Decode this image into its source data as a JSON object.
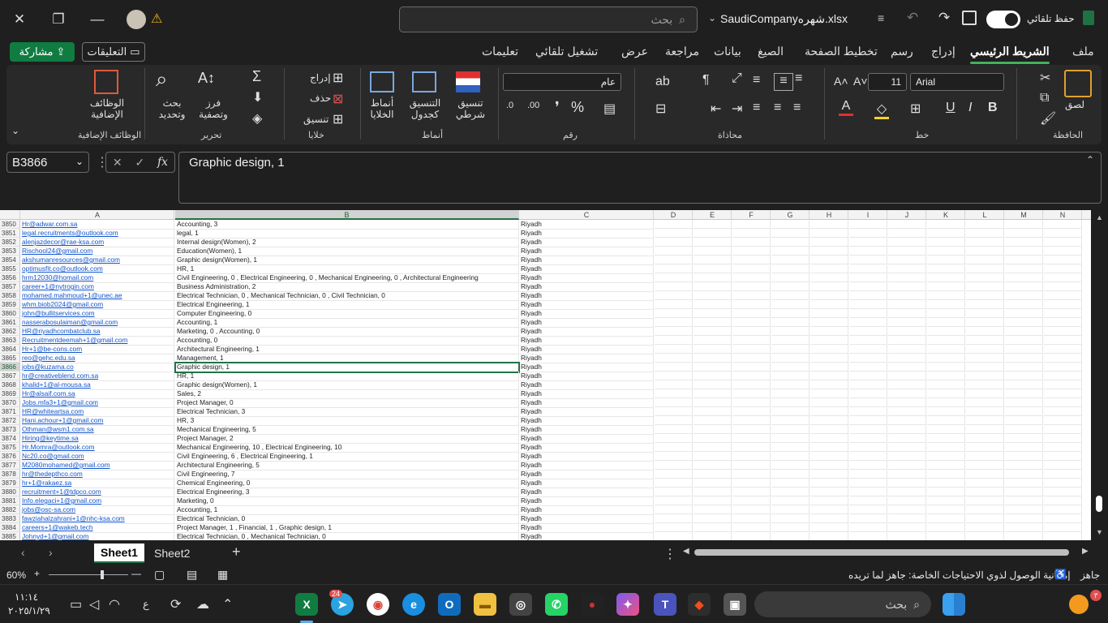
{
  "titlebar": {
    "filename": "SaudiCompanyشهره.xlsx",
    "search_placeholder": "بحث",
    "autosave_label": "حفظ تلقائي"
  },
  "tabs": [
    "ملف",
    "الشريط الرئيسي",
    "إدراج",
    "رسم",
    "تخطيط الصفحة",
    "الصيغ",
    "بيانات",
    "مراجعة",
    "عرض",
    "تشغيل تلقائي",
    "تعليمات"
  ],
  "active_tab": "الشريط الرئيسي",
  "share_label": "مشاركة",
  "comments_label": "التعليقات",
  "ribbon": {
    "clipboard": {
      "label": "الحافظة",
      "paste": "لصق"
    },
    "font": {
      "label": "خط",
      "name": "Arial",
      "size": "11"
    },
    "alignment": {
      "label": "محاذاة"
    },
    "number": {
      "label": "رقم",
      "format": "عام"
    },
    "styles": {
      "label": "أنماط",
      "conditional": "تنسيق شرطي",
      "table": "التنسيق كجدول",
      "cell_styles": "أنماط الخلايا"
    },
    "cells": {
      "label": "خلايا",
      "insert": "إدراج",
      "delete": "حذف",
      "format": "تنسيق"
    },
    "editing": {
      "label": "تحرير",
      "sort": "فرز وتصفية",
      "find": "بحث وتحديد"
    },
    "addins": {
      "label": "الوظائف الإضافية",
      "button": "الوظائف الإضافية"
    }
  },
  "formula_bar": {
    "name_box": "B3866",
    "content": "Graphic design, 1"
  },
  "columns": [
    "A",
    "B",
    "C",
    "D",
    "E",
    "F",
    "G",
    "H",
    "I",
    "J",
    "K",
    "L",
    "M",
    "N"
  ],
  "selected_row": "3866",
  "rows": [
    {
      "n": "3850",
      "a": "Hr@adwar.com.sa",
      "b": "Accounting, 3",
      "c": "Riyadh"
    },
    {
      "n": "3851",
      "a": "legal.recruitments@outlook.com",
      "b": "legal, 1",
      "c": "Riyadh"
    },
    {
      "n": "3852",
      "a": "alenjazdecor@rae-ksa.com",
      "b": "Internal design(Women), 2",
      "c": "Riyadh"
    },
    {
      "n": "3853",
      "a": "Rischool24@gmail.com",
      "b": "Education(Women), 1",
      "c": "Riyadh"
    },
    {
      "n": "3854",
      "a": "akshumanresources@gmail.com",
      "b": "Graphic design(Women), 1",
      "c": "Riyadh"
    },
    {
      "n": "3855",
      "a": "optimusfit.co@outlook.com",
      "b": "HR, 1",
      "c": "Riyadh"
    },
    {
      "n": "3856",
      "a": "hrm12030@homail.com",
      "b": "Civil Engineering, 0  , Electrical Engineering, 0 , Mechanical Engineering, 0 , Architectural Engineering",
      "c": "Riyadh"
    },
    {
      "n": "3857",
      "a": "career+1@nytrogin.com",
      "b": "Business Administration, 2",
      "c": "Riyadh"
    },
    {
      "n": "3858",
      "a": "mohamed.mahmoud+1@unec.ae",
      "b": "Electrical Technician, 0  , Mechanical Technician, 0 , Civil Technician, 0",
      "c": "Riyadh"
    },
    {
      "n": "3859",
      "a": "whm.biob2024@gmail.com",
      "b": "Electrical Engineering, 1",
      "c": "Riyadh"
    },
    {
      "n": "3860",
      "a": "john@bullitservices.com",
      "b": "Computer Engineering, 0",
      "c": "Riyadh"
    },
    {
      "n": "3861",
      "a": "nasserabosulaiman@gmail.com",
      "b": "Accounting, 1",
      "c": "Riyadh"
    },
    {
      "n": "3862",
      "a": "HR@riyadhcombatclub.sa",
      "b": "Marketing, 0 , Accounting, 0",
      "c": "Riyadh"
    },
    {
      "n": "3863",
      "a": "Recruitmentdeemah+1@gmail.com",
      "b": "Accounting, 0",
      "c": "Riyadh"
    },
    {
      "n": "3864",
      "a": "Hr+1@be-cons.com",
      "b": "Architectural Engineering, 1",
      "c": "Riyadh"
    },
    {
      "n": "3865",
      "a": "reo@gehc.edu.sa",
      "b": "Management, 1",
      "c": "Riyadh"
    },
    {
      "n": "3866",
      "a": "jobs@kuzama.co",
      "b": "Graphic design, 1",
      "c": "Riyadh"
    },
    {
      "n": "3867",
      "a": "hr@creativeblend.com.sa",
      "b": "HR, 1",
      "c": "Riyadh"
    },
    {
      "n": "3868",
      "a": "khalid+1@al-mousa.sa",
      "b": "Graphic design(Women), 1",
      "c": "Riyadh"
    },
    {
      "n": "3869",
      "a": "Hr@alsaif.com.sa",
      "b": "Sales, 2",
      "c": "Riyadh"
    },
    {
      "n": "3870",
      "a": "Jobs.mfa3+1@gmail.com",
      "b": "Project Manager, 0",
      "c": "Riyadh"
    },
    {
      "n": "3871",
      "a": "HR@whiteartsa.com",
      "b": "Electrical Technician, 3",
      "c": "Riyadh"
    },
    {
      "n": "3872",
      "a": "Hani.achour+1@gmail.com",
      "b": "HR, 3",
      "c": "Riyadh"
    },
    {
      "n": "3873",
      "a": "Othman@wsm1.com.sa",
      "b": "Mechanical Engineering, 5",
      "c": "Riyadh"
    },
    {
      "n": "3874",
      "a": "Hiring@keytime.sa",
      "b": "Project Manager, 2",
      "c": "Riyadh"
    },
    {
      "n": "3875",
      "a": "Hr.Momra@outlook.com",
      "b": "Mechanical Engineering, 10  , Electrical Engineering, 10",
      "c": "Riyadh"
    },
    {
      "n": "3876",
      "a": "Nc20.co@gmail.com",
      "b": "Civil Engineering, 6  , Electrical Engineering, 1",
      "c": "Riyadh"
    },
    {
      "n": "3877",
      "a": "M2080mohamed@gmail.com",
      "b": "Architectural Engineering, 5",
      "c": "Riyadh"
    },
    {
      "n": "3878",
      "a": "hr@thedepthco.com",
      "b": "Civil Engineering, 7",
      "c": "Riyadh"
    },
    {
      "n": "3879",
      "a": "hr+1@rakaez.sa",
      "b": "Chemical Engineering, 0",
      "c": "Riyadh"
    },
    {
      "n": "3880",
      "a": "recruitment+1@tdpco.com",
      "b": "Electrical  Engineering, 3",
      "c": "Riyadh"
    },
    {
      "n": "3881",
      "a": "Info.elegaci+1@gmail.com",
      "b": "Marketing, 0",
      "c": "Riyadh"
    },
    {
      "n": "3882",
      "a": "jobs@osc-sa.com",
      "b": "Accounting, 1",
      "c": "Riyadh"
    },
    {
      "n": "3883",
      "a": "fawziahalzahrani+1@nhc-ksa.com",
      "b": "Electrical Technician, 0",
      "c": "Riyadh"
    },
    {
      "n": "3884",
      "a": "careers+1@wakeb.tech",
      "b": "Project Manager, 1 , Financial, 1 , Graphic design, 1",
      "c": "Riyadh"
    },
    {
      "n": "3885",
      "a": "Johnyd+1@gmail.com",
      "b": "Electrical Technician, 0 , Mechanical Technician, 0",
      "c": "Riyadh"
    }
  ],
  "sheets": [
    "Sheet1",
    "Sheet2"
  ],
  "active_sheet": "Sheet1",
  "status": {
    "ready": "جاهز",
    "accessibility": "إمكانية الوصول لذوي الاحتياجات الخاصة: جاهز لما تريده",
    "zoom": "60%"
  },
  "taskbar": {
    "time": "١١:١٤",
    "date": "٢٠٢٥/١/٢٩",
    "search_placeholder": "بحث",
    "lang": "ع",
    "telegram_badge": "24",
    "notif_badge": "٣"
  },
  "colors": {
    "accent": "#217346",
    "link": "#1155cc",
    "share": "#107c41"
  }
}
